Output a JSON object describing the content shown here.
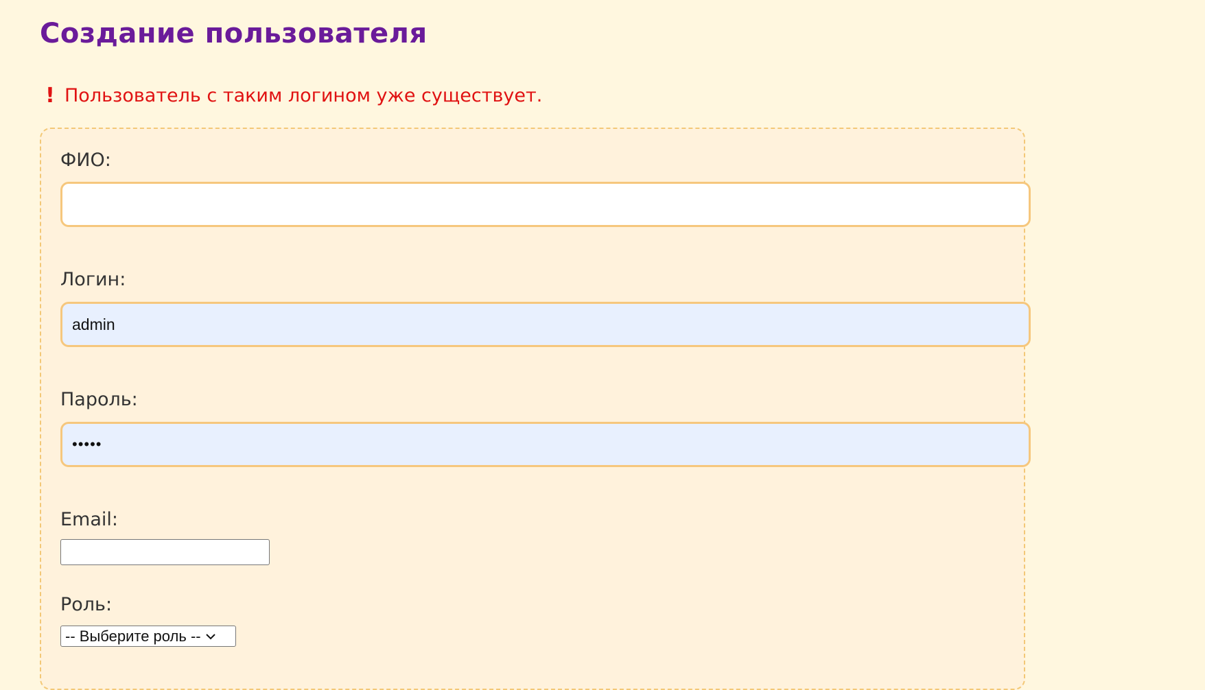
{
  "page": {
    "title": "Создание пользователя"
  },
  "error": {
    "icon": "exclamation-icon",
    "icon_glyph": "!",
    "message": "Пользователь с таким логином уже существует.",
    "color": "#e01212"
  },
  "form": {
    "fio": {
      "label": "ФИО:",
      "value": ""
    },
    "login": {
      "label": "Логин:",
      "value": "admin"
    },
    "password": {
      "label": "Пароль:",
      "value": "•••••"
    },
    "email": {
      "label": "Email:",
      "value": ""
    },
    "role": {
      "label": "Роль:",
      "selected": "-- Выберите роль --"
    }
  },
  "colors": {
    "background": "#fff7df",
    "title": "#6a1b9a",
    "input_border": "#f6c77d",
    "autofill_background": "#e8f0fe"
  }
}
